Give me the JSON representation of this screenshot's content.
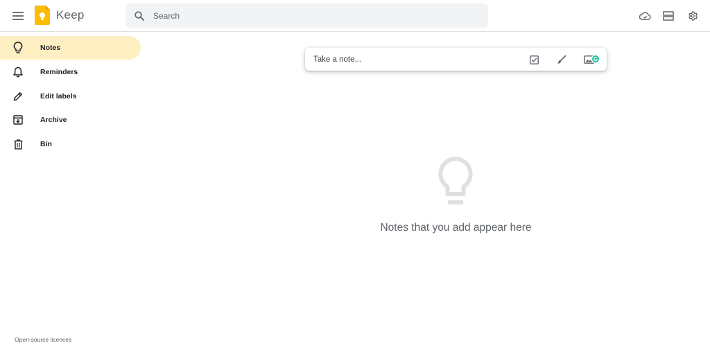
{
  "header": {
    "app_title": "Keep",
    "search_placeholder": "Search",
    "icons": [
      "menu-icon",
      "keep-logo",
      "search-icon",
      "cloud-icon",
      "list-view-icon",
      "settings-icon"
    ]
  },
  "sidebar": {
    "items": [
      {
        "label": "Notes",
        "icon": "lightbulb-icon",
        "active": true
      },
      {
        "label": "Reminders",
        "icon": "bell-icon",
        "active": false
      },
      {
        "label": "Edit labels",
        "icon": "pencil-icon",
        "active": false
      },
      {
        "label": "Archive",
        "icon": "archive-icon",
        "active": false
      },
      {
        "label": "Bin",
        "icon": "trash-icon",
        "active": false
      }
    ],
    "footer": "Open-source licences"
  },
  "note_bar": {
    "placeholder": "Take a note...",
    "icons": [
      "checkbox-icon",
      "brush-icon",
      "image-icon"
    ],
    "grammarly_badge": "G"
  },
  "empty_state": {
    "icon": "lightbulb-icon",
    "message": "Notes that you add appear here"
  },
  "colors": {
    "active_nav": "#feefc3",
    "logo_yellow": "#fbbc04",
    "search_bg": "#f1f3f4",
    "icon_gray": "#5f6368",
    "empty_icon": "#e0e0e0",
    "grammarly": "#15c39a"
  }
}
